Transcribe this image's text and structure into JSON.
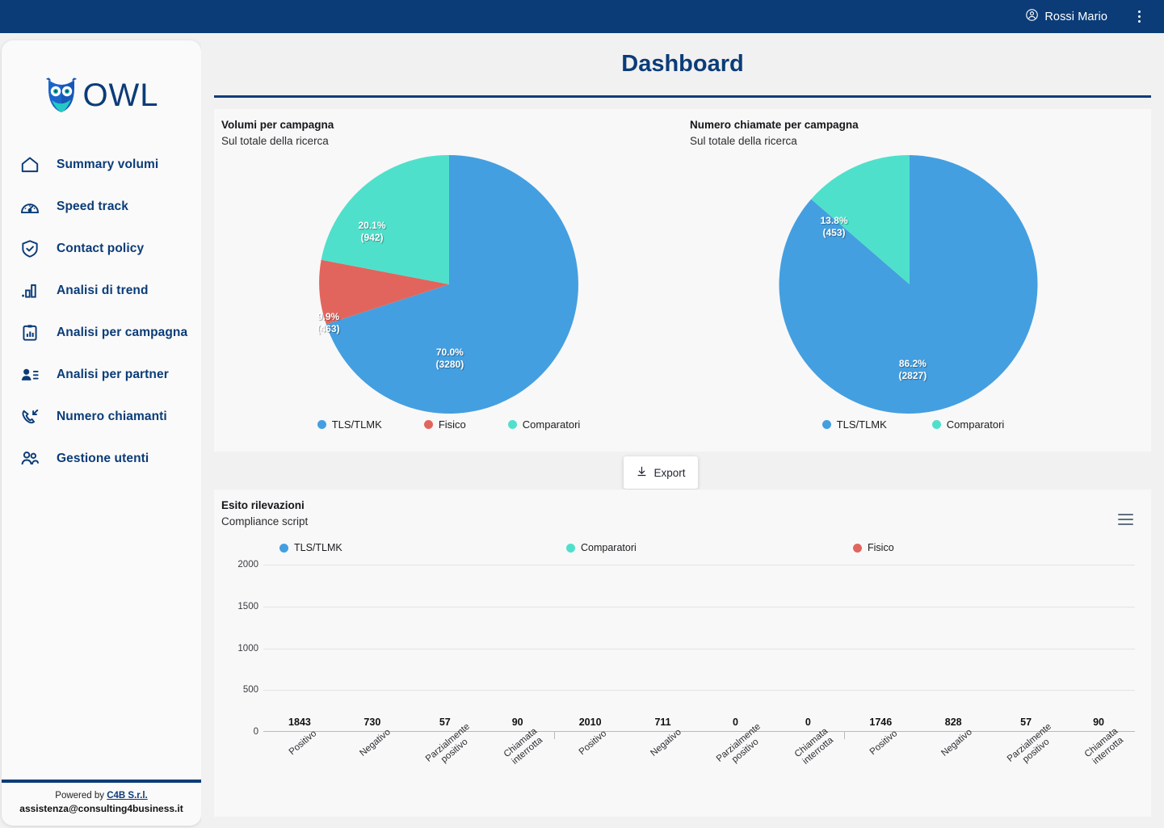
{
  "topbar": {
    "user_name": "Rossi Mario",
    "account_icon": "account-circle-icon",
    "menu_icon": "kebab-menu-icon"
  },
  "sidebar": {
    "logo_text": "OWL",
    "items": [
      {
        "label": "Summary volumi",
        "icon": "home-icon"
      },
      {
        "label": "Speed track",
        "icon": "speedometer-icon"
      },
      {
        "label": "Contact policy",
        "icon": "shield-check-icon"
      },
      {
        "label": "Analisi di trend",
        "icon": "bar-chart-icon"
      },
      {
        "label": "Analisi per campagna",
        "icon": "clipboard-chart-icon"
      },
      {
        "label": "Analisi per partner",
        "icon": "user-list-icon"
      },
      {
        "label": "Numero chiamanti",
        "icon": "phone-incoming-icon"
      },
      {
        "label": "Gestione utenti",
        "icon": "users-icon"
      }
    ],
    "footer": {
      "powered_prefix": "Powered by ",
      "company": "C4B S.r.l.",
      "email": "assistenza@consulting4business.it"
    }
  },
  "header": {
    "title": "Dashboard"
  },
  "toolbar": {
    "export_label": "Export",
    "export_icon": "download-icon",
    "menu_icon": "hamburger-menu-icon"
  },
  "colors": {
    "blue": "#449FE0",
    "teal": "#4FE0CB",
    "red": "#E2655D",
    "grey": "#C3C8CC",
    "orange": "#F0A358",
    "navy": "#0b3c78"
  },
  "chart_data": [
    {
      "type": "pie",
      "title": "Volumi per campagna",
      "subtitle": "Sul totale della ricerca",
      "categories": [
        "TLS/TLMK",
        "Fisico",
        "Comparatori"
      ],
      "values": [
        3280,
        463,
        942
      ],
      "percents": [
        "70.0%",
        "9.9%",
        "20.1%"
      ],
      "labels": [
        "70.0%\n(3280)",
        "9.9%\n(463)",
        "20.1%\n(942)"
      ],
      "colors": [
        "#449FE0",
        "#E2655D",
        "#4FE0CB"
      ],
      "legend_position": "bottom"
    },
    {
      "type": "pie",
      "title": "Numero chiamate per campagna",
      "subtitle": "Sul totale della ricerca",
      "categories": [
        "TLS/TLMK",
        "Comparatori"
      ],
      "values": [
        2827,
        453
      ],
      "percents": [
        "86.2%",
        "13.8%"
      ],
      "labels": [
        "86.2%\n(2827)",
        "13.8%\n(453)"
      ],
      "colors": [
        "#449FE0",
        "#4FE0CB"
      ],
      "legend_position": "bottom"
    },
    {
      "type": "bar",
      "title": "Esito rilevazioni",
      "subtitle": "Compliance script",
      "groups": [
        "TLS/TLMK",
        "Comparatori",
        "Fisico"
      ],
      "categories": [
        "Positivo",
        "Negativo",
        "Parzialmente positivo",
        "Chiamata interrotta"
      ],
      "series": [
        {
          "name": "TLS/TLMK",
          "values": [
            1843,
            730,
            57,
            90
          ]
        },
        {
          "name": "Comparatori",
          "values": [
            2010,
            711,
            0,
            0
          ]
        },
        {
          "name": "Fisico",
          "values": [
            1746,
            828,
            57,
            90
          ]
        }
      ],
      "bar_colors": [
        "#449FE0",
        "#C3C8CC",
        "#F0A358",
        "#E2655D"
      ],
      "legend_colors": [
        "#449FE0",
        "#4FE0CB",
        "#E2655D"
      ],
      "yticks": [
        0,
        500,
        1000,
        1500,
        2000
      ],
      "ylim": [
        0,
        2100
      ],
      "ylabel": "",
      "xlabel": "",
      "grid": true,
      "legend_position": "top"
    }
  ]
}
